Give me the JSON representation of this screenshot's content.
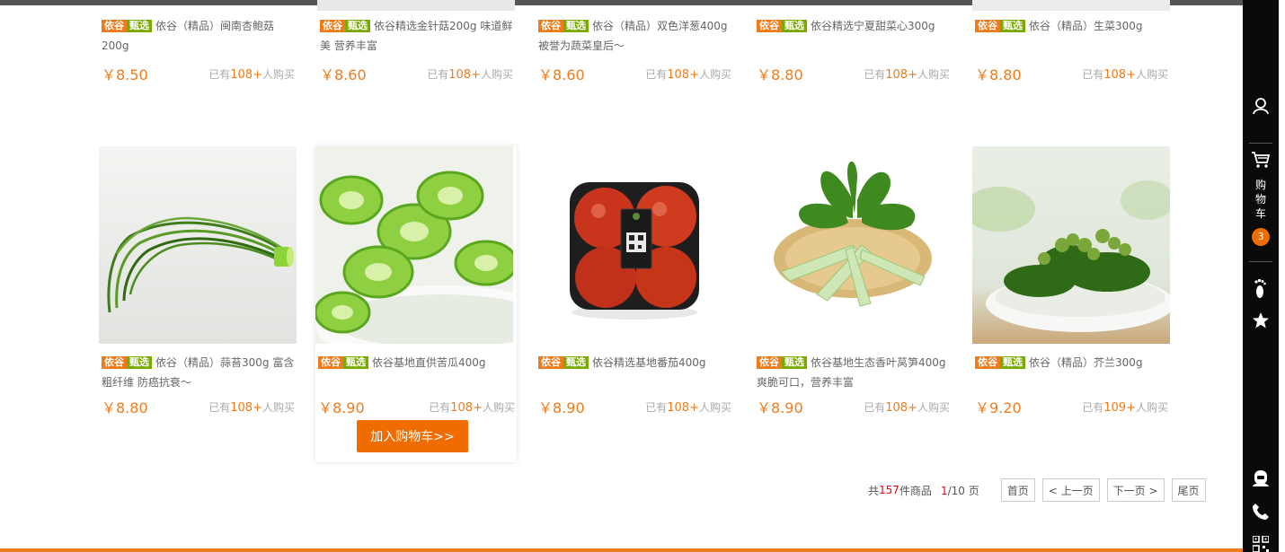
{
  "tag": {
    "brand": "依谷",
    "select": "甄选"
  },
  "sold_prefix": "已有",
  "sold_suffix": "人购买",
  "row1": [
    {
      "name": "依谷（精品）闽南杏鲍菇200g",
      "price": "￥8.50",
      "sold": "108+"
    },
    {
      "name": "依谷精选金针菇200g  味道鲜美 营养丰富",
      "price": "￥8.60",
      "sold": "108+"
    },
    {
      "name": "依谷（精品）双色洋葱400g 被誉为蔬菜皇后～",
      "price": "￥8.60",
      "sold": "108+"
    },
    {
      "name": "依谷精选宁夏甜菜心300g",
      "price": "￥8.80",
      "sold": "108+"
    },
    {
      "name": "依谷（精品）生菜300g",
      "price": "￥8.80",
      "sold": "108+"
    }
  ],
  "row2": [
    {
      "name": "依谷（精品）蒜苔300g  富含粗纤维 防癌抗衰～",
      "price": "￥8.80",
      "sold": "108+",
      "icon": "garlic-sprout-image"
    },
    {
      "name": "依谷基地直供苦瓜400g",
      "price": "￥8.90",
      "sold": "108+",
      "icon": "bitter-melon-image"
    },
    {
      "name": "依谷精选基地番茄400g",
      "price": "￥8.90",
      "sold": "108+",
      "icon": "tomato-image"
    },
    {
      "name": "依谷基地生态香叶莴笋400g  爽脆可口，营养丰富",
      "price": "￥8.90",
      "sold": "108+",
      "icon": "lettuce-stem-image"
    },
    {
      "name": "依谷（精品）芥兰300g",
      "price": "￥9.20",
      "sold": "109+",
      "icon": "kale-image"
    }
  ],
  "add_to_cart": "加入购物车>>",
  "pager": {
    "total_prefix": "共",
    "total": "157",
    "total_suffix": "件商品",
    "current": "1",
    "sep": "/",
    "pages": "10",
    "page_unit": "页",
    "first": "首页",
    "prev": "< 上一页",
    "next": "下一页 >",
    "last": "尾页"
  },
  "sidebar": {
    "cart_label_1": "购",
    "cart_label_2": "物",
    "cart_label_3": "车",
    "cart_count": "3"
  },
  "colors": {
    "accent": "#f07b1a",
    "green_tag": "#7aa900",
    "sidebar": "#0a0a0a"
  }
}
